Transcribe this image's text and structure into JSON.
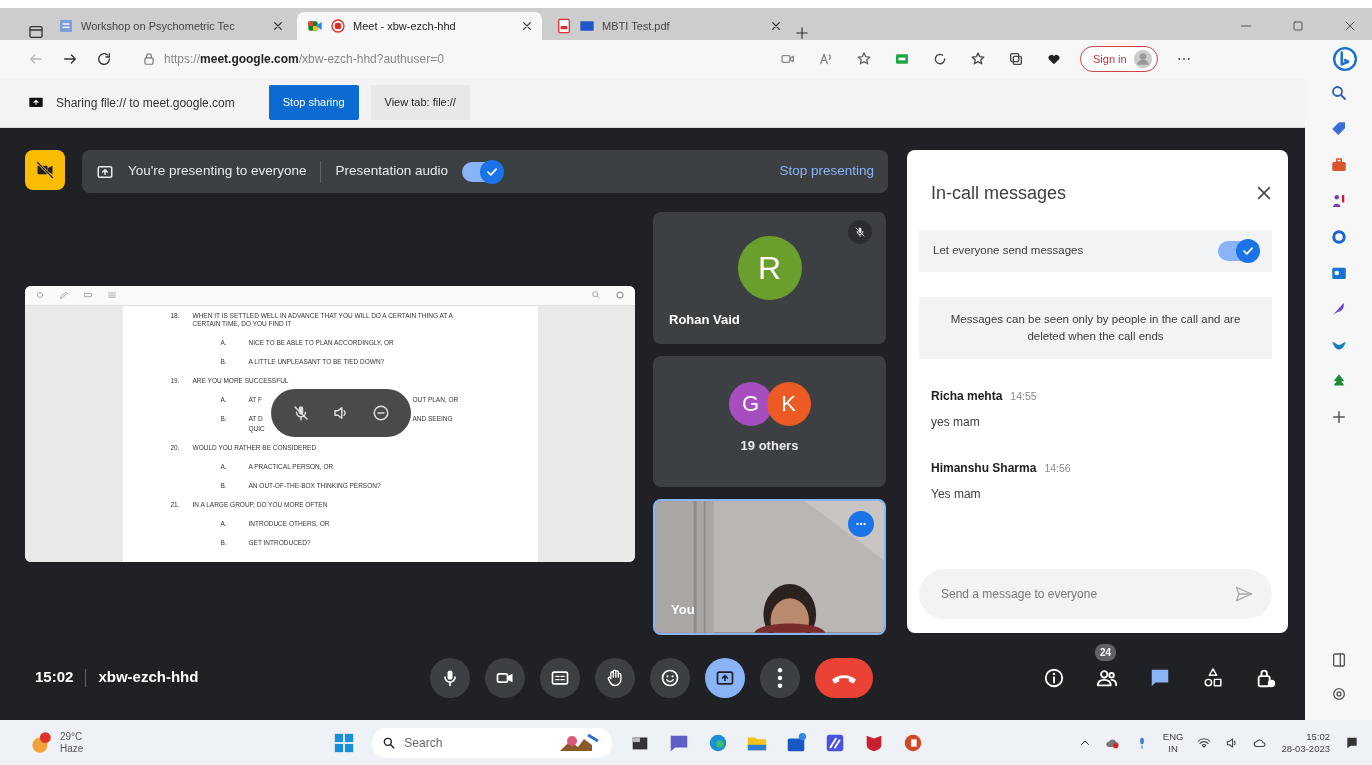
{
  "browser": {
    "tabs": [
      {
        "title": "Workshop on Psychometric Tec",
        "kind": "form",
        "recording": false,
        "selected": false
      },
      {
        "title": "Meet - xbw-ezch-hhd",
        "kind": "meet",
        "recording": true,
        "selected": true
      },
      {
        "title": "MBTI Test.pdf",
        "kind": "pdf",
        "recording": false,
        "selected": false
      }
    ],
    "url": "https://**meet.google.com**/xbw-ezch-hhd?authuser=0",
    "sign_in": "Sign in"
  },
  "sharing_bar": {
    "text": "Sharing file:// to meet.google.com",
    "stop_button": "Stop sharing",
    "view_button": "View tab: file://"
  },
  "meet": {
    "presenting_text": "You're presenting to everyone",
    "audio_label": "Presentation audio",
    "audio_on": true,
    "stop_presenting": "Stop presenting",
    "document": {
      "lines": [
        {
          "kind": "question",
          "number": "18.",
          "text": "WHEN IT IS SETTLED WELL IN ADVANCE THAT YOU WILL DO A CERTAIN THING AT A CERTAIN TIME, DO YOU FIND IT"
        },
        {
          "kind": "option",
          "number": "A.",
          "text": "NICE TO BE ABLE TO PLAN ACCORDINGLY, OR"
        },
        {
          "kind": "option",
          "number": "B.",
          "text": "A LITTLE UNPLEASANT TO BE TIED DOWN?"
        },
        {
          "kind": "question",
          "number": "19.",
          "text": "ARE YOU MORE SUCCESSFUL"
        },
        {
          "kind": "option",
          "number": "A.",
          "parts": [
            "AT F",
            "OUT PLAN, OR"
          ]
        },
        {
          "kind": "option",
          "number": "B.",
          "parts": [
            "AT D",
            "AND SEEING"
          ]
        },
        {
          "kind": "continuation",
          "parts": [
            "QUIC"
          ]
        },
        {
          "kind": "question",
          "number": "20.",
          "text": "WOULD YOU RATHER BE CONSIDERED"
        },
        {
          "kind": "option",
          "number": "A.",
          "text": "A PRACTICAL PERSON, OR"
        },
        {
          "kind": "option",
          "number": "B.",
          "text": "AN OUT-OF-THE-BOX THINKING PERSON?"
        },
        {
          "kind": "question",
          "number": "21.",
          "text": "IN A LARGE GROUP, DO YOU MORE OFTEN"
        },
        {
          "kind": "option",
          "number": "A.",
          "text": "INTRODUCE OTHERS, OR"
        },
        {
          "kind": "option",
          "number": "B.",
          "text": "GET INTRODUCED?"
        }
      ]
    },
    "tiles": [
      {
        "kind": "avatar",
        "name": "Rohan Vaid",
        "muted": true,
        "initials": [
          {
            "letter": "R",
            "color": "#6a9f2e"
          }
        ]
      },
      {
        "kind": "group",
        "caption": "19 others",
        "initials": [
          {
            "letter": "G",
            "color": "#a64dbf"
          },
          {
            "letter": "K",
            "color": "#ee5a24"
          }
        ]
      },
      {
        "kind": "video",
        "name": "You"
      }
    ],
    "time": "15:02",
    "code": "xbw-ezch-hhd",
    "controls": [
      {
        "kind": "mic",
        "selected": false
      },
      {
        "kind": "camera",
        "selected": false
      },
      {
        "kind": "captions",
        "selected": false
      },
      {
        "kind": "hand",
        "selected": false
      },
      {
        "kind": "emoji",
        "selected": false
      },
      {
        "kind": "present",
        "selected": true
      },
      {
        "kind": "more",
        "selected": false
      },
      {
        "kind": "hangup",
        "selected": false
      }
    ],
    "side_buttons": [
      {
        "kind": "info",
        "selected": false
      },
      {
        "kind": "people",
        "selected": false,
        "badge": "24"
      },
      {
        "kind": "chat",
        "selected": true
      },
      {
        "kind": "activities",
        "selected": false
      },
      {
        "kind": "lock",
        "selected": false
      }
    ]
  },
  "chat": {
    "title": "In-call messages",
    "allow_label": "Let everyone send messages",
    "allow_on": true,
    "notice": "Messages can be seen only by people in the call and are deleted when the call ends",
    "messages": [
      {
        "sender": "Richa mehta",
        "time": "14:55",
        "text": "yes mam"
      },
      {
        "sender": "Himanshu Sharma",
        "time": "14:56",
        "text": "Yes mam"
      }
    ],
    "placeholder": "Send a message to everyone"
  },
  "taskbar": {
    "temperature": "29°C",
    "condition": "Haze",
    "search": "Search",
    "language": "ENG",
    "region": "IN",
    "time": "15:02",
    "date": "28-03-2023"
  }
}
